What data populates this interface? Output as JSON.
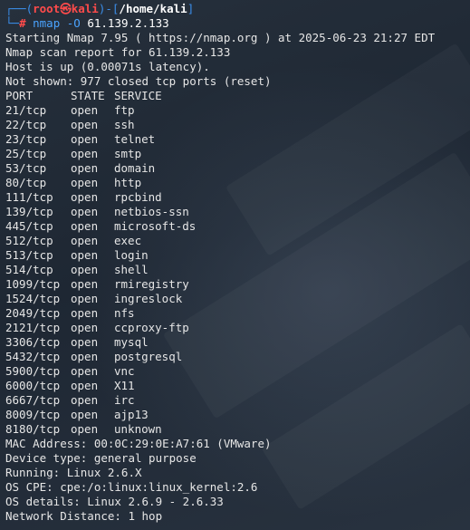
{
  "prompt": {
    "open_bracket": "┌──(",
    "user": "root",
    "at": "㉿",
    "host": "kali",
    "mid": ")-[",
    "path": "/home/kali",
    "close": "]",
    "second_prefix": "└─",
    "symbol": "#"
  },
  "command": {
    "name": "nmap",
    "flag": "-O",
    "target": "61.139.2.133"
  },
  "output_head": [
    "Starting Nmap 7.95 ( https://nmap.org ) at 2025-06-23 21:27 EDT",
    "Nmap scan report for 61.139.2.133",
    "Host is up (0.00071s latency).",
    "Not shown: 977 closed tcp ports (reset)"
  ],
  "table_header": {
    "port": "PORT",
    "state": "STATE",
    "service": "SERVICE"
  },
  "ports": [
    {
      "port": "21/tcp",
      "state": "open",
      "service": "ftp"
    },
    {
      "port": "22/tcp",
      "state": "open",
      "service": "ssh"
    },
    {
      "port": "23/tcp",
      "state": "open",
      "service": "telnet"
    },
    {
      "port": "25/tcp",
      "state": "open",
      "service": "smtp"
    },
    {
      "port": "53/tcp",
      "state": "open",
      "service": "domain"
    },
    {
      "port": "80/tcp",
      "state": "open",
      "service": "http"
    },
    {
      "port": "111/tcp",
      "state": "open",
      "service": "rpcbind"
    },
    {
      "port": "139/tcp",
      "state": "open",
      "service": "netbios-ssn"
    },
    {
      "port": "445/tcp",
      "state": "open",
      "service": "microsoft-ds"
    },
    {
      "port": "512/tcp",
      "state": "open",
      "service": "exec"
    },
    {
      "port": "513/tcp",
      "state": "open",
      "service": "login"
    },
    {
      "port": "514/tcp",
      "state": "open",
      "service": "shell"
    },
    {
      "port": "1099/tcp",
      "state": "open",
      "service": "rmiregistry"
    },
    {
      "port": "1524/tcp",
      "state": "open",
      "service": "ingreslock"
    },
    {
      "port": "2049/tcp",
      "state": "open",
      "service": "nfs"
    },
    {
      "port": "2121/tcp",
      "state": "open",
      "service": "ccproxy-ftp"
    },
    {
      "port": "3306/tcp",
      "state": "open",
      "service": "mysql"
    },
    {
      "port": "5432/tcp",
      "state": "open",
      "service": "postgresql"
    },
    {
      "port": "5900/tcp",
      "state": "open",
      "service": "vnc"
    },
    {
      "port": "6000/tcp",
      "state": "open",
      "service": "X11"
    },
    {
      "port": "6667/tcp",
      "state": "open",
      "service": "irc"
    },
    {
      "port": "8009/tcp",
      "state": "open",
      "service": "ajp13"
    },
    {
      "port": "8180/tcp",
      "state": "open",
      "service": "unknown"
    }
  ],
  "output_tail": [
    "MAC Address: 00:0C:29:0E:A7:61 (VMware)",
    "Device type: general purpose",
    "Running: Linux 2.6.X",
    "OS CPE: cpe:/o:linux:linux_kernel:2.6",
    "OS details: Linux 2.6.9 - 2.6.33",
    "Network Distance: 1 hop"
  ]
}
